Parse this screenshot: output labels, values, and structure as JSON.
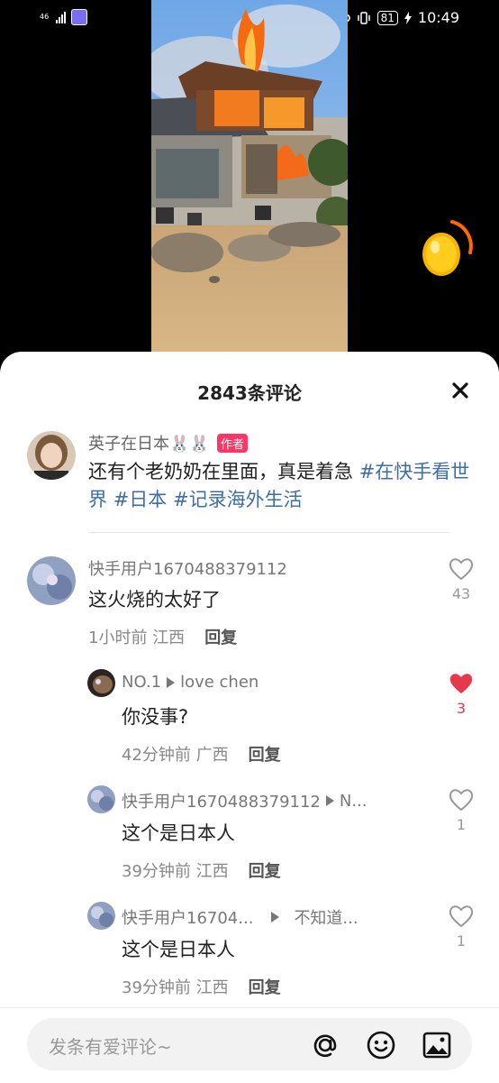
{
  "status": {
    "network": "46",
    "battery": "81",
    "time": "10:49"
  },
  "comments_panel": {
    "title": "2843条评论",
    "post": {
      "author": "英子在日本🐰🐰",
      "author_tag": "作者",
      "text": "还有个老奶奶在里面，真是着急 ",
      "hashtags": [
        "#在快手看世界",
        "#日本",
        "#记录海外生活"
      ]
    },
    "comments": [
      {
        "user": "快手用户1670488379112",
        "text": "这火烧的太好了",
        "time": "1小时前",
        "location": "江西",
        "reply_label": "回复",
        "likes": "43",
        "liked": false
      },
      {
        "user": "NO.1",
        "reply_to": "love chen",
        "text": "你没事?",
        "time": "42分钟前",
        "location": "广西",
        "reply_label": "回复",
        "likes": "3",
        "liked": true
      },
      {
        "user": "快手用户1670488379112",
        "reply_to": "N...",
        "text": "这个是日本人",
        "time": "39分钟前",
        "location": "江西",
        "reply_label": "回复",
        "likes": "1",
        "liked": false
      },
      {
        "user": "快手用户16704...",
        "reply_to": "不知道...",
        "text": "这个是日本人",
        "time": "39分钟前",
        "location": "江西",
        "reply_label": "回复",
        "likes": "1",
        "liked": false
      }
    ]
  },
  "input": {
    "placeholder": "发条有爱评论~"
  },
  "icons": [
    "at-icon",
    "emoji-icon",
    "image-icon",
    "close-icon",
    "heart-icon"
  ],
  "colors": {
    "accent_red": "#e6394c",
    "hashtag_blue": "#3f6ea5",
    "author_tag": "#fe3666"
  }
}
